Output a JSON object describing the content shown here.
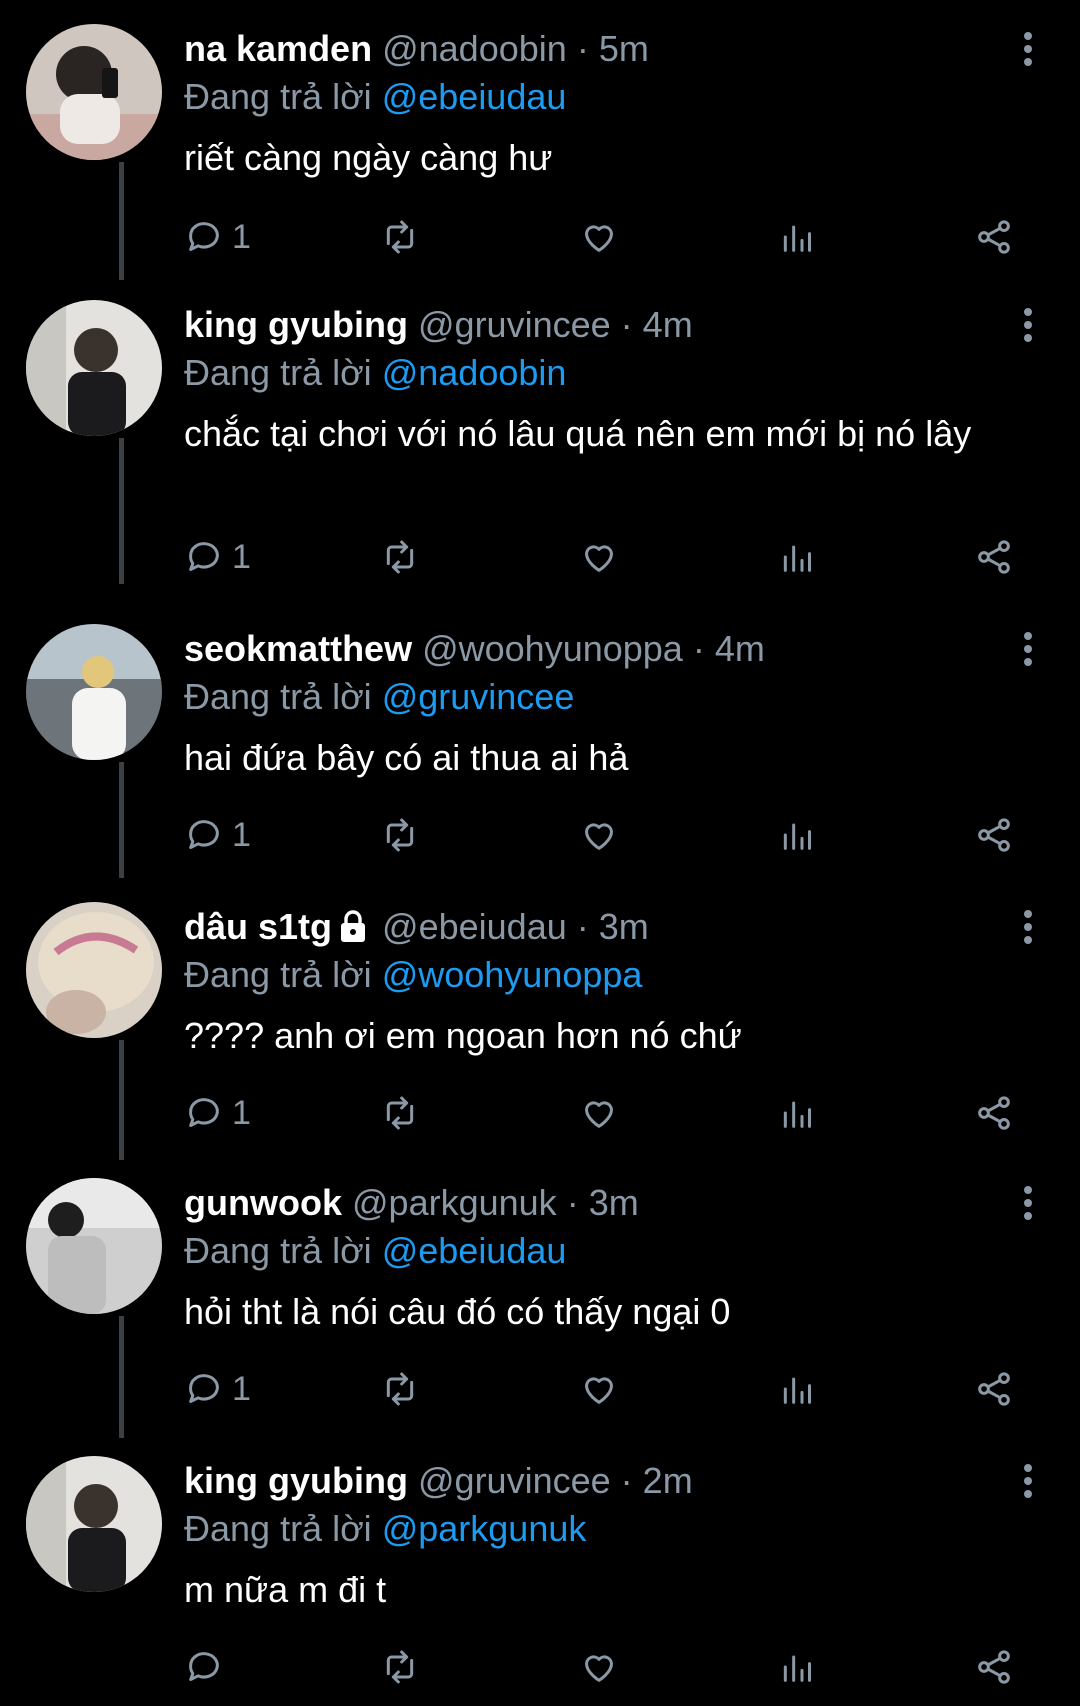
{
  "reply_prefix": "Đang trả lời",
  "colors": {
    "background": "#000000",
    "link": "#1d9bf0",
    "muted": "#8b98a5",
    "text": "#ffffff",
    "thread_line": "#3b4045"
  },
  "icons": {
    "reply": "comment-icon",
    "retweet": "retweet-icon",
    "like": "heart-icon",
    "views": "bar-chart-icon",
    "share": "share-icon",
    "more": "vertical-dots-icon",
    "lock": "lock-icon"
  },
  "tweets": [
    {
      "name": "na kamden",
      "handle": "@nadoobin",
      "time": "5m",
      "reply_to": "@ebeiudau",
      "text": "riết càng ngày càng hư",
      "reply_count": "1",
      "locked": false
    },
    {
      "name": "king gyubing",
      "handle": "@gruvincee",
      "time": "4m",
      "reply_to": "@nadoobin",
      "text": "chắc tại chơi với nó lâu quá nên em mới bị nó lây",
      "reply_count": "1",
      "locked": false
    },
    {
      "name": "seokmatthew",
      "handle": "@woohyunoppa",
      "time": "4m",
      "reply_to": "@gruvincee",
      "text": "hai đứa bây có ai thua ai hả",
      "reply_count": "1",
      "locked": false
    },
    {
      "name": "dâu s1tg",
      "handle": "@ebeiudau",
      "time": "3m",
      "reply_to": "@woohyunoppa",
      "text": "???? anh ơi em ngoan hơn nó chứ",
      "reply_count": "1",
      "locked": true
    },
    {
      "name": "gunwook",
      "handle": "@parkgunuk",
      "time": "3m",
      "reply_to": "@ebeiudau",
      "text": "hỏi tht là nói câu đó có thấy ngại 0",
      "reply_count": "1",
      "locked": false
    },
    {
      "name": "king gyubing",
      "handle": "@gruvincee",
      "time": "2m",
      "reply_to": "@parkgunuk",
      "text": "m nữa m đi t",
      "reply_count": "",
      "locked": false
    }
  ]
}
